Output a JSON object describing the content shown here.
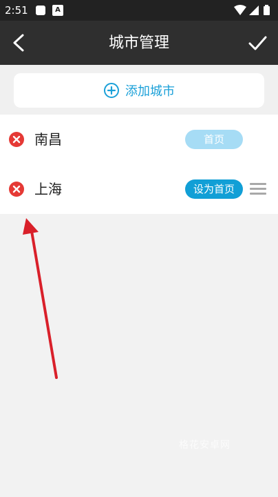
{
  "status_bar": {
    "time": "2:51",
    "a_icon_letter": "A"
  },
  "app_bar": {
    "title": "城市管理",
    "back_icon": "chevron-left-icon",
    "confirm_icon": "check-icon"
  },
  "add_city": {
    "label": "添加城市",
    "icon": "plus-circle-icon"
  },
  "cities": [
    {
      "name": "南昌",
      "home_label": "首页"
    },
    {
      "name": "上海",
      "action_label": "设为首页"
    }
  ],
  "watermark": "格花安卓网",
  "colors": {
    "accent": "#119fd6",
    "home_badge": "#a6dcf5",
    "delete": "#e53935",
    "appbar": "#2f2f2f",
    "arrow": "#d9202a"
  }
}
